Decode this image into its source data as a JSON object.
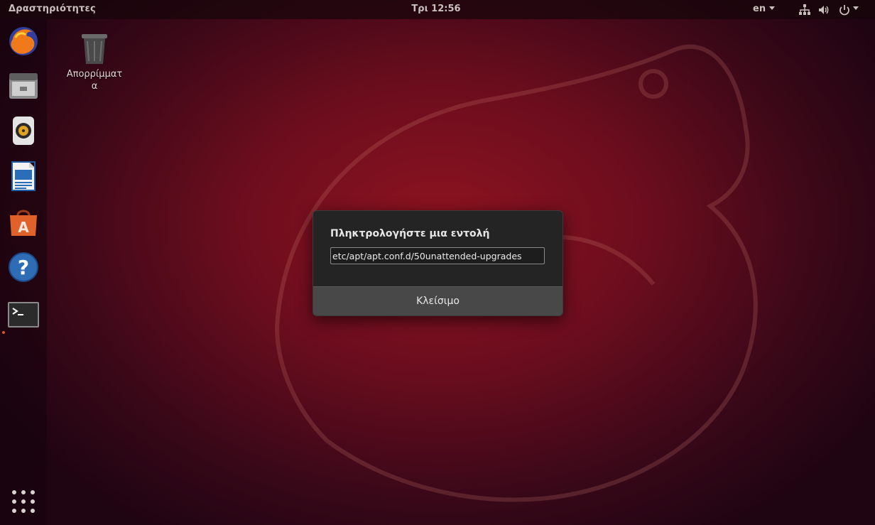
{
  "topbar": {
    "activities_label": "Δραστηριότητες",
    "clock": "Τρι 12:56",
    "language": "en",
    "tray_icons": [
      "network-icon",
      "volume-icon",
      "power-icon"
    ]
  },
  "dock": {
    "items": [
      {
        "name": "firefox-icon"
      },
      {
        "name": "files-icon"
      },
      {
        "name": "rhythmbox-icon"
      },
      {
        "name": "libreoffice-writer-icon"
      },
      {
        "name": "software-center-icon"
      },
      {
        "name": "help-icon"
      },
      {
        "name": "terminal-icon"
      }
    ],
    "show_apps_icon": "app-grid-icon"
  },
  "desktop": {
    "trash_label": "Απορρίμματα"
  },
  "dialog": {
    "title": "Πληκτρολογήστε μια εντολή",
    "input_value": "etc/apt/apt.conf.d/50unattended-upgrades",
    "close_label": "Κλείσιμο"
  },
  "colors": {
    "accent": "#e0531f",
    "dialog_bg": "#242424",
    "dialog_footer": "#484848",
    "wallpaper": "#8c1226"
  }
}
